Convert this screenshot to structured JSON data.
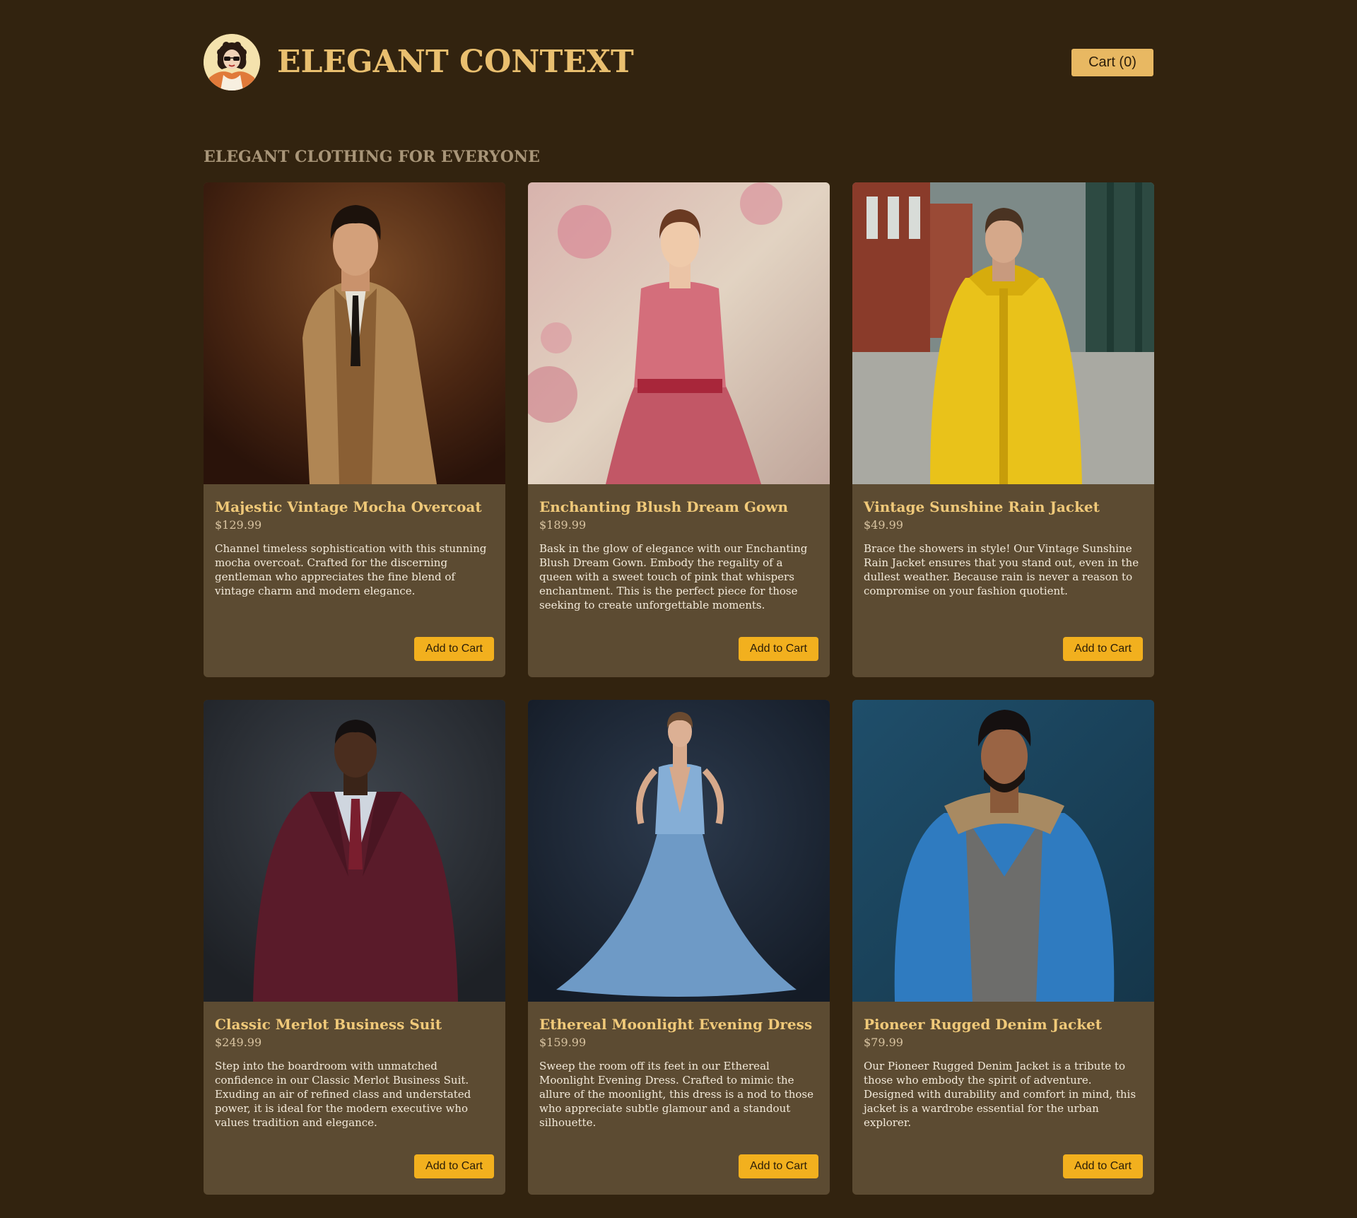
{
  "header": {
    "brand": "ELEGANT CONTEXT",
    "logo_icon": "vintage-woman-portrait-logo",
    "cart_label": "Cart (0)"
  },
  "tagline": "ELEGANT CLOTHING FOR EVERYONE",
  "products": [
    {
      "title": "Majestic Vintage Mocha Overcoat",
      "price": "$129.99",
      "description": "Channel timeless sophistication with this stunning mocha overcoat. Crafted for the discerning gentleman who appreciates the fine blend of vintage charm and modern elegance.",
      "button": "Add to Cart",
      "image": "man-in-mocha-overcoat"
    },
    {
      "title": "Enchanting Blush Dream Gown",
      "price": "$189.99",
      "description": "Bask in the glow of elegance with our Enchanting Blush Dream Gown. Embody the regality of a queen with a sweet touch of pink that whispers enchantment. This is the perfect piece for those seeking to create unforgettable moments.",
      "button": "Add to Cart",
      "image": "woman-in-pink-gown"
    },
    {
      "title": "Vintage Sunshine Rain Jacket",
      "price": "$49.99",
      "description": "Brace the showers in style! Our Vintage Sunshine Rain Jacket ensures that you stand out, even in the dullest weather. Because rain is never a reason to compromise on your fashion quotient.",
      "button": "Add to Cart",
      "image": "man-in-yellow-rain-jacket"
    },
    {
      "title": "Classic Merlot Business Suit",
      "price": "$249.99",
      "description": "Step into the boardroom with unmatched confidence in our Classic Merlot Business Suit. Exuding an air of refined class and understated power, it is ideal for the modern executive who values tradition and elegance.",
      "button": "Add to Cart",
      "image": "man-in-merlot-suit"
    },
    {
      "title": "Ethereal Moonlight Evening Dress",
      "price": "$159.99",
      "description": "Sweep the room off its feet in our Ethereal Moonlight Evening Dress. Crafted to mimic the allure of the moonlight, this dress is a nod to those who appreciate subtle glamour and a standout silhouette.",
      "button": "Add to Cart",
      "image": "woman-in-blue-evening-dress"
    },
    {
      "title": "Pioneer Rugged Denim Jacket",
      "price": "$79.99",
      "description": "Our Pioneer Rugged Denim Jacket is a tribute to those who embody the spirit of adventure. Designed with durability and comfort in mind, this jacket is a wardrobe essential for the urban explorer.",
      "button": "Add to Cart",
      "image": "man-in-denim-jacket"
    }
  ],
  "colors": {
    "background": "#32230f",
    "card": "#5c4b32",
    "brand": "#e9bf6f",
    "button": "#f2b01e",
    "cart_button": "#e8b862"
  }
}
